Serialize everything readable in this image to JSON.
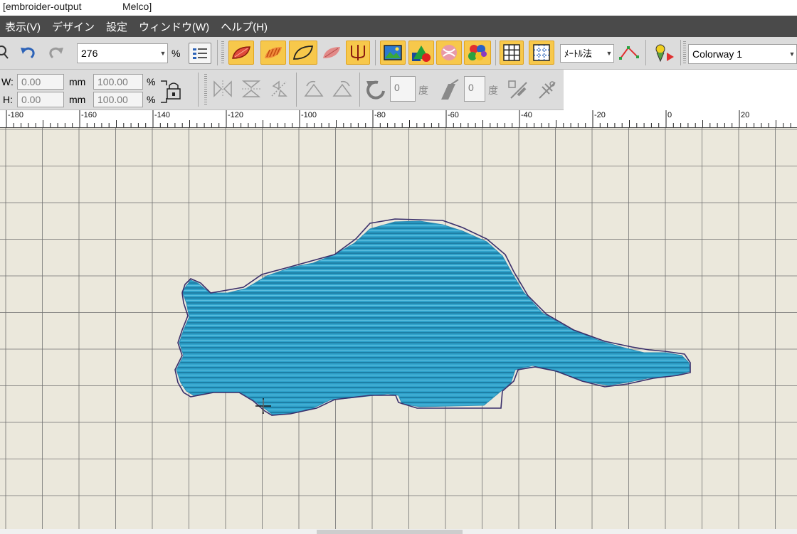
{
  "window": {
    "title_left": "[embroider-output",
    "title_right": "Melco]"
  },
  "menu": {
    "items": [
      "表示(V)",
      "デザイン",
      "設定",
      "ウィンドウ(W)",
      "ヘルプ(H)"
    ]
  },
  "toolbar": {
    "zoom_value": "276",
    "zoom_unit": "%",
    "measure_method": "ﾒｰﾄﾙ法",
    "colorway": "Colorway 1"
  },
  "transform": {
    "w_label": "W:",
    "h_label": "H:",
    "w_value": "0.00",
    "h_value": "0.00",
    "w_unit": "mm",
    "h_unit": "mm",
    "w_percent": "100.00",
    "h_percent": "100.00",
    "percent_sign": "%",
    "rotate_value": "0",
    "slant_value": "0",
    "degree_unit": "度"
  },
  "ruler": {
    "labels": [
      "-180",
      "-160",
      "-140",
      "-120",
      "-100",
      "-80",
      "-60",
      "-40",
      "-20",
      "0",
      "20"
    ]
  },
  "colors": {
    "stitch": "#2b9ec8",
    "outline": "#3a2f6b",
    "canvas": "#ebe8dc",
    "grid": "#707070",
    "accent_button": "#f7c84b"
  },
  "icons": [
    "zoom-icon",
    "undo-icon",
    "redo-icon",
    "zoom-list-icon",
    "satin-fill-icon",
    "fill-stitch-icon",
    "outline-icon",
    "feather-icon",
    "column-icon",
    "image-icon",
    "shapes-icon",
    "applique-icon",
    "colors-icon",
    "grid-icon",
    "grid-snap-icon",
    "node-edit-icon",
    "stitch-player-icon",
    "lock-icon",
    "mirror-horizontal-icon",
    "mirror-vertical-icon",
    "flip-icon",
    "rotate-left-icon",
    "rotate-right-icon",
    "rotate-icon",
    "slant-icon",
    "align-icon",
    "align-center-icon"
  ]
}
